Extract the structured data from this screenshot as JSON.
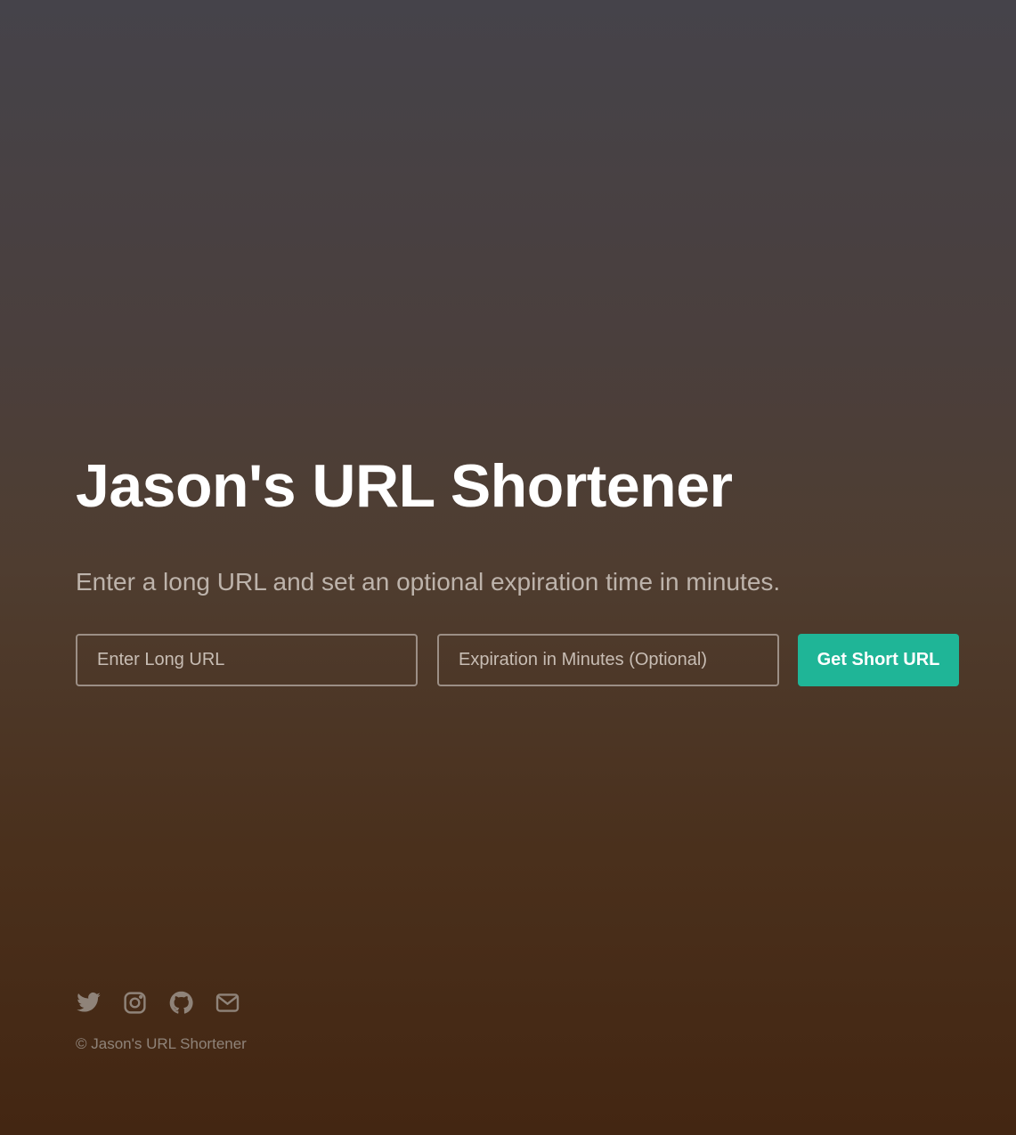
{
  "hero": {
    "title": "Jason's URL Shortener",
    "subtitle": "Enter a long URL and set an optional expiration time in minutes."
  },
  "form": {
    "long_url": {
      "value": "",
      "placeholder": "Enter Long URL"
    },
    "expiration": {
      "value": "",
      "placeholder": "Expiration in Minutes (Optional)"
    },
    "submit_label": "Get Short URL"
  },
  "footer": {
    "social_icons": [
      "twitter-icon",
      "instagram-icon",
      "github-icon",
      "mail-icon"
    ],
    "copyright": "© Jason's URL Shortener"
  },
  "colors": {
    "accent": "#1fb597",
    "icon": "#8f8379"
  }
}
